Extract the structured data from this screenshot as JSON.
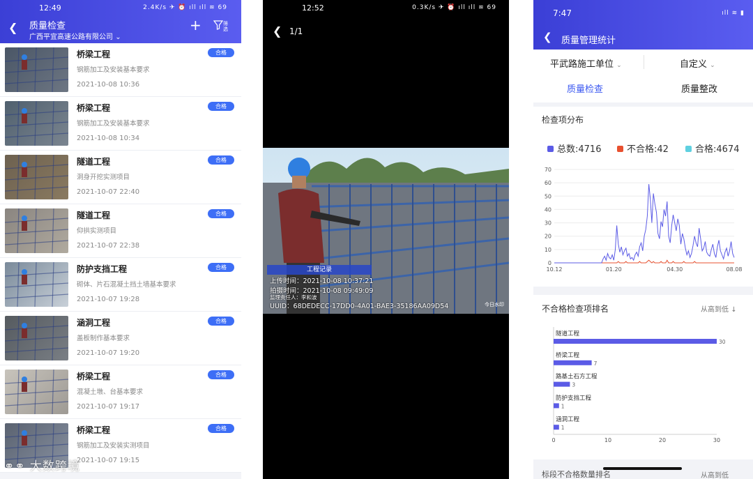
{
  "panel1": {
    "status_time": "12:49",
    "status_right": "2.4K/s ✈ ⏰ ıll ıll ≋ 69",
    "title": "质量检查",
    "company": "广西平宜高速公路有限公司",
    "filter_label": "筛选",
    "badge_text": "合格",
    "items": [
      {
        "title": "桥梁工程",
        "sub": "钢筋加工及安装基本要求",
        "time": "2021-10-08 10:36"
      },
      {
        "title": "桥梁工程",
        "sub": "钢筋加工及安装基本要求",
        "time": "2021-10-08 10:34"
      },
      {
        "title": "隧道工程",
        "sub": "洞身开挖实测项目",
        "time": "2021-10-07 22:40"
      },
      {
        "title": "隧道工程",
        "sub": "仰拱实测项目",
        "time": "2021-10-07 22:38"
      },
      {
        "title": "防护支挡工程",
        "sub": "砌体、片石混凝土挡土墙基本要求",
        "time": "2021-10-07 19:28"
      },
      {
        "title": "涵洞工程",
        "sub": "盖板制作基本要求",
        "time": "2021-10-07 19:20"
      },
      {
        "title": "桥梁工程",
        "sub": "混凝土墩、台基本要求",
        "time": "2021-10-07 19:17"
      },
      {
        "title": "桥梁工程",
        "sub": "钢筋加工及安装实测项目",
        "time": "2021-10-07 19:15"
      }
    ],
    "watermark": "大数跨境"
  },
  "panel2": {
    "status_time": "12:52",
    "status_right": "0.3K/s ✈ ⏰ ıll ıll ≋ 69",
    "page": "1/1",
    "stamp": {
      "header": "工程记录",
      "upload": "上传时间：2021-10-08 10:37:21",
      "shot": "拍摄时间：2021-10-08 09:49:09",
      "supervisor": "监理责任人：李和波",
      "uuid": "UUID：68DEDECC-17DD0-4A01-BAE3-35186AA09D54",
      "corner": "今日水印"
    }
  },
  "panel3": {
    "status_time": "7:47",
    "title": "质量管理统计",
    "unit_select": "平武路施工单位",
    "range_select": "自定义",
    "tabs": [
      "质量检查",
      "质量整改"
    ],
    "dist_title": "检查项分布",
    "legend": [
      {
        "label": "总数:4716",
        "color": "#5b5be6"
      },
      {
        "label": "不合格:42",
        "color": "#e8502f"
      },
      {
        "label": "合格:4674",
        "color": "#5fd0e0"
      }
    ],
    "rank_title": "不合格检查项排名",
    "sort_label": "从高到低",
    "next_title": "标段不合格数量排名",
    "next_sort": "从高到低"
  },
  "chart_data": [
    {
      "type": "line",
      "x_tick_labels": [
        "10.12",
        "01.20",
        "04.30",
        "08.08"
      ],
      "y_ticks": [
        0,
        10,
        20,
        30,
        40,
        50,
        60,
        70
      ],
      "ylim": [
        0,
        70
      ],
      "series": [
        {
          "name": "总数",
          "color": "#5b5be6",
          "values": [
            0,
            0,
            0,
            0,
            0,
            0,
            0,
            0,
            0,
            0,
            0,
            0,
            0,
            0,
            0,
            0,
            0,
            0,
            0,
            0,
            0,
            0,
            0,
            0,
            0,
            0,
            0,
            0,
            0,
            0,
            0,
            0,
            3,
            5,
            2,
            7,
            4,
            3,
            6,
            2,
            10,
            28,
            14,
            8,
            12,
            6,
            9,
            11,
            5,
            7,
            3,
            4,
            2,
            6,
            8,
            5,
            12,
            15,
            9,
            20,
            25,
            35,
            59,
            48,
            30,
            52,
            44,
            38,
            22,
            18,
            31,
            27,
            40,
            35,
            46,
            20,
            15,
            28,
            36,
            30,
            24,
            33,
            28,
            14,
            22,
            18,
            11,
            6,
            9,
            4,
            7,
            13,
            20,
            15,
            12,
            26,
            18,
            9,
            11,
            16,
            8,
            6,
            5,
            10,
            14,
            7,
            4,
            12,
            17,
            9,
            6,
            3,
            8,
            11,
            5,
            9,
            16,
            7,
            4
          ]
        },
        {
          "name": "不合格",
          "color": "#e8502f",
          "values": [
            0,
            0,
            0,
            0,
            0,
            0,
            0,
            0,
            0,
            0,
            0,
            0,
            0,
            0,
            0,
            0,
            0,
            0,
            0,
            0,
            0,
            0,
            0,
            0,
            0,
            0,
            0,
            0,
            0,
            0,
            0,
            0,
            0,
            0,
            0,
            0,
            0,
            0,
            0,
            0,
            0,
            0,
            1,
            0,
            0,
            0,
            0,
            1,
            0,
            0,
            0,
            0,
            0,
            0,
            0,
            0,
            1,
            0,
            0,
            0,
            0,
            1,
            2,
            1,
            0,
            1,
            0,
            0,
            0,
            0,
            1,
            0,
            0,
            0,
            2,
            0,
            0,
            0,
            1,
            0,
            0,
            0,
            0,
            0,
            0,
            1,
            0,
            0,
            0,
            0,
            0,
            0,
            1,
            0,
            0,
            0,
            0,
            0,
            0,
            0,
            0,
            0,
            0,
            0,
            0,
            0,
            0,
            0,
            0,
            0,
            0,
            0,
            0,
            0,
            0,
            0,
            0,
            0,
            0
          ]
        }
      ]
    },
    {
      "type": "bar",
      "orientation": "horizontal",
      "categories": [
        "隧道工程",
        "桥梁工程",
        "路基土石方工程",
        "防护支挡工程",
        "涵洞工程"
      ],
      "values": [
        30,
        7,
        3,
        1,
        1
      ],
      "xlim": [
        0,
        30
      ],
      "x_ticks": [
        0,
        10,
        20,
        30
      ],
      "color": "#5b5be6"
    }
  ]
}
